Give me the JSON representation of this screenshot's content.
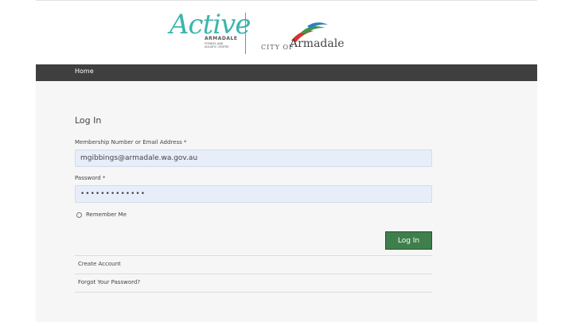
{
  "header": {
    "active_logo": {
      "script": "Active",
      "line1": "ARMADALE",
      "line2": "FITNESS AND AQUATIC CENTRE"
    },
    "city_logo": {
      "prefix": "CITY OF",
      "name": "Armadale"
    },
    "colors": {
      "active_teal": "#3db5ad",
      "swoosh_red": "#d9322e",
      "swoosh_green": "#3a9a48",
      "swoosh_blue": "#2f7fc4"
    }
  },
  "nav": {
    "home": "Home"
  },
  "form": {
    "title": "Log In",
    "email_label": "Membership Number or Email Address *",
    "email_value": "mgibbings@armadale.wa.gov.au",
    "password_label": "Password *",
    "password_value": "•••••••••••••",
    "remember_label": "Remember Me",
    "submit_label": "Log In",
    "submit_color": "#3f7f4b"
  },
  "links": {
    "create_account": "Create Account",
    "forgot_password": "Forgot Your Password?"
  }
}
